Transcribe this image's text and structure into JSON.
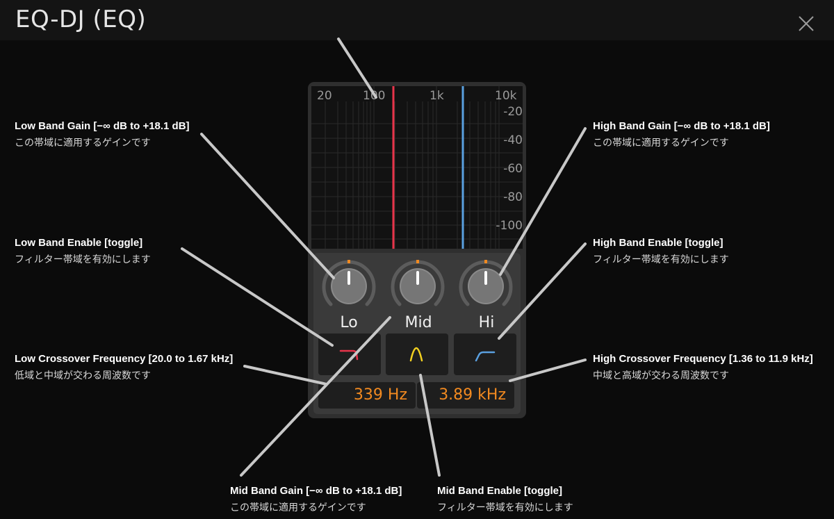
{
  "window": {
    "title": "EQ-DJ (EQ)"
  },
  "graph": {
    "freq_labels": [
      "20",
      "100",
      "1k",
      "10k"
    ],
    "db_labels": [
      "-20",
      "-40",
      "-60",
      "-80",
      "-100"
    ],
    "low_crossover_color": "#e8344a",
    "high_crossover_color": "#5aa0e0"
  },
  "bands": {
    "low": {
      "label": "Lo"
    },
    "mid": {
      "label": "Mid"
    },
    "high": {
      "label": "Hi"
    }
  },
  "enable_buttons": {
    "low": {
      "icon": "low-shelf-icon",
      "color": "#e8344a"
    },
    "mid": {
      "icon": "bell-icon",
      "color": "#f2d020"
    },
    "high": {
      "icon": "high-shelf-icon",
      "color": "#5aa0e0"
    }
  },
  "crossover": {
    "low_value": "339 Hz",
    "high_value": "3.89 kHz",
    "value_color": "#f28a20"
  },
  "annotations": {
    "low_gain": {
      "title": "Low Band Gain [−∞ dB to +18.1 dB]",
      "desc": "この帯域に適用するゲインです"
    },
    "low_enable": {
      "title": "Low Band Enable [toggle]",
      "desc": "フィルター帯域を有効にします"
    },
    "low_crossover": {
      "title": "Low Crossover Frequency [20.0 to 1.67 kHz]",
      "desc": "低域と中域が交わる周波数です"
    },
    "mid_gain": {
      "title": "Mid Band Gain [−∞ dB to +18.1 dB]",
      "desc": "この帯域に適用するゲインです"
    },
    "mid_enable": {
      "title": "Mid Band Enable [toggle]",
      "desc": "フィルター帯域を有効にします"
    },
    "high_gain": {
      "title": "High Band Gain [−∞ dB to +18.1 dB]",
      "desc": "この帯域に適用するゲインです"
    },
    "high_enable": {
      "title": "High Band Enable [toggle]",
      "desc": "フィルター帯域を有効にします"
    },
    "high_crossover": {
      "title": "High Crossover Frequency [1.36 to 11.9 kHz]",
      "desc": "中域と高域が交わる周波数です"
    }
  }
}
